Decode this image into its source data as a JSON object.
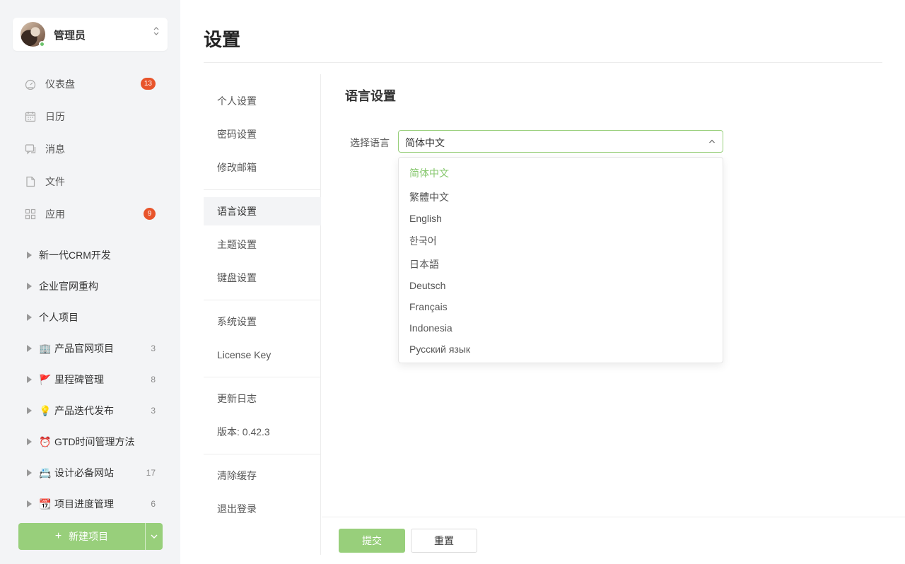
{
  "user": {
    "name": "管理员",
    "status": "online"
  },
  "nav": [
    {
      "label": "仪表盘",
      "icon": "dashboard-icon",
      "badge": "13"
    },
    {
      "label": "日历",
      "icon": "calendar-icon"
    },
    {
      "label": "消息",
      "icon": "message-icon"
    },
    {
      "label": "文件",
      "icon": "file-icon"
    },
    {
      "label": "应用",
      "icon": "apps-icon",
      "badge": "9"
    }
  ],
  "projects": [
    {
      "label": "新一代CRM开发"
    },
    {
      "label": "企业官网重构"
    },
    {
      "label": "个人项目"
    },
    {
      "label": "产品官网项目",
      "emoji": "🏢",
      "count": "3"
    },
    {
      "label": "里程碑管理",
      "emoji": "🚩",
      "count": "8"
    },
    {
      "label": "产品迭代发布",
      "emoji": "💡",
      "count": "3"
    },
    {
      "label": "GTD时间管理方法",
      "emoji": "⏰"
    },
    {
      "label": "设计必备网站",
      "emoji": "📇",
      "count": "17"
    },
    {
      "label": "项目进度管理",
      "emoji": "📆",
      "count": "6"
    }
  ],
  "new_project_label": "新建项目",
  "page_title": "设置",
  "settings_nav": [
    {
      "label": "个人设置"
    },
    {
      "label": "密码设置"
    },
    {
      "label": "修改邮箱"
    },
    {
      "label": "语言设置",
      "active": true
    },
    {
      "label": "主题设置"
    },
    {
      "label": "键盘设置"
    },
    {
      "label": "系统设置"
    },
    {
      "label": "License Key"
    },
    {
      "label": "更新日志"
    },
    {
      "label": "版本: 0.42.3"
    },
    {
      "label": "清除缓存"
    },
    {
      "label": "退出登录"
    }
  ],
  "language": {
    "section_title": "语言设置",
    "field_label": "选择语言",
    "selected": "简体中文",
    "options": [
      "简体中文",
      "繁體中文",
      "English",
      "한국어",
      "日本語",
      "Deutsch",
      "Français",
      "Indonesia",
      "Русский язык"
    ]
  },
  "actions": {
    "submit": "提交",
    "reset": "重置"
  },
  "colors": {
    "accent": "#98cf7b",
    "badge": "#e8542b",
    "selected_option": "#86c76d"
  }
}
